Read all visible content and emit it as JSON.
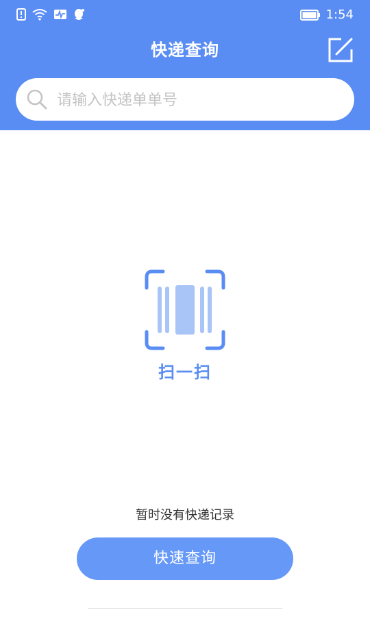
{
  "status_bar": {
    "time": "1:54",
    "icons": [
      "notification-alert-icon",
      "wifi-icon",
      "activity-icon",
      "qq-penguin-icon"
    ],
    "battery_icon": "battery-icon"
  },
  "header": {
    "title": "快递查询",
    "edit_icon": "edit-icon"
  },
  "search": {
    "placeholder": "请输入快递单单号",
    "icon": "search-icon"
  },
  "scan": {
    "label": "扫一扫",
    "icon": "barcode-scan-icon"
  },
  "empty_state": {
    "text": "暂时没有快递记录"
  },
  "actions": {
    "query_label": "快速查询"
  },
  "colors": {
    "primary": "#5a8df3",
    "button": "#6699f7",
    "scan_light": "#a9c4f7"
  }
}
